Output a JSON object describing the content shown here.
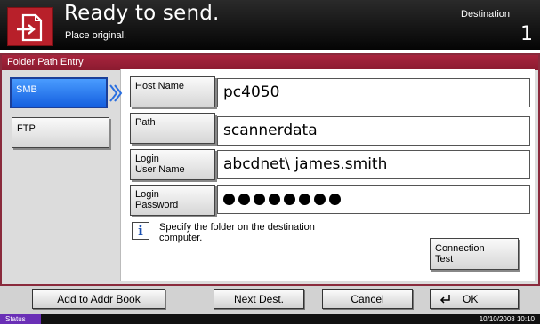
{
  "header": {
    "title": "Ready to send.",
    "subtitle": "Place original.",
    "destination_label": "Destination",
    "destination_count": "1",
    "icon": "document-send-icon"
  },
  "dialog": {
    "title": "Folder Path Entry"
  },
  "protocols": [
    {
      "label": "SMB",
      "selected": true
    },
    {
      "label": "FTP",
      "selected": false
    }
  ],
  "fields": {
    "host": {
      "label": "Host Name",
      "value": "pc4050"
    },
    "path": {
      "label": "Path",
      "value": "scannerdata"
    },
    "login_user": {
      "label_line1": "Login",
      "label_line2": "User Name",
      "value": "abcdnet\\ james.smith"
    },
    "login_password": {
      "label_line1": "Login",
      "label_line2": "Password",
      "masked_length": 8
    }
  },
  "info": {
    "icon": "info-icon",
    "line1": "Specify the folder on the destination",
    "line2": "computer."
  },
  "connection_test": {
    "line1": "Connection",
    "line2": "Test"
  },
  "bottom_bar": {
    "add_to_addr_book": "Add to Addr Book",
    "next_dest": "Next Dest.",
    "cancel": "Cancel",
    "ok": "OK"
  },
  "status_bar": {
    "label": "Status",
    "datetime": "10/10/2008   10:10"
  },
  "colors": {
    "header_bg": "#0a0a0a",
    "frame_accent": "#8b1b30",
    "selected_button": "#1560e0",
    "status_label": "#6a2fb6"
  }
}
